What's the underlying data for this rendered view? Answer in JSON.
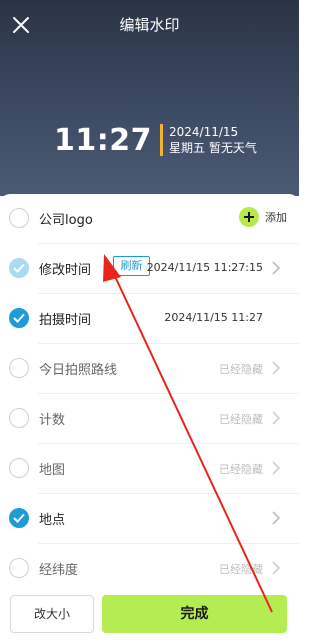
{
  "header": {
    "title": "编辑水印"
  },
  "watermark": {
    "time": "11:27",
    "date": "2024/11/15",
    "weekday_weather": "星期五 暂无天气"
  },
  "rows": [
    {
      "label": "公司logo",
      "state": "off",
      "action": "添加"
    },
    {
      "label": "修改时间",
      "state": "faint",
      "badge": "刷新",
      "value": "2024/11/15 11:27:15"
    },
    {
      "label": "拍摄时间",
      "state": "on",
      "value": "2024/11/15 11:27"
    },
    {
      "label": "今日拍照路线",
      "state": "off",
      "value": "已经隐藏"
    },
    {
      "label": "计数",
      "state": "off",
      "value": "已经隐藏"
    },
    {
      "label": "地图",
      "state": "off",
      "value": "已经隐藏"
    },
    {
      "label": "地点",
      "state": "on",
      "value": ""
    },
    {
      "label": "经纬度",
      "state": "off",
      "value": "已经隐藏"
    }
  ],
  "footer": {
    "resize_label": "改大小",
    "done_label": "完成"
  },
  "colors": {
    "accent_green": "#b4ec51",
    "check_blue": "#1f9bd7",
    "annotation_red": "#e8241c"
  }
}
